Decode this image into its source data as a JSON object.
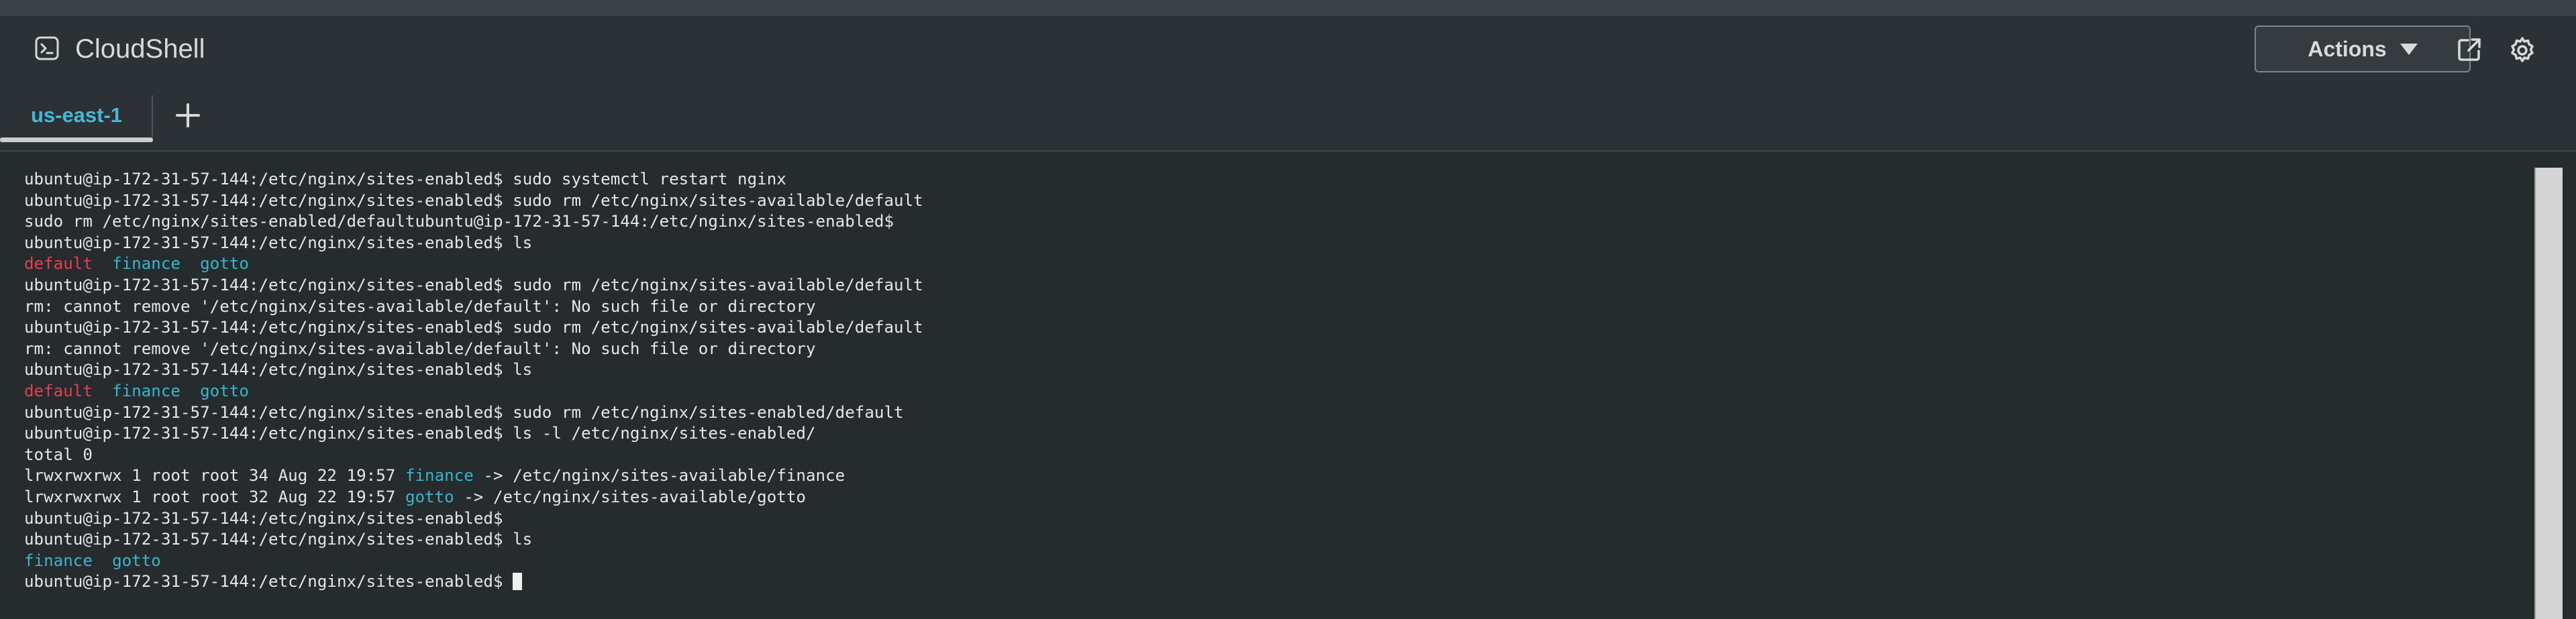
{
  "app": {
    "title": "CloudShell"
  },
  "header": {
    "actions_label": "Actions",
    "icons": [
      "terminal-icon",
      "external-link-icon",
      "gear-icon",
      "caret-down-icon"
    ]
  },
  "tabs": [
    {
      "label": "us-east-1",
      "active": true
    }
  ],
  "add_tab_label": "+",
  "terminal": {
    "lines": [
      [
        {
          "text": "ubuntu@ip-172-31-57-144:/etc/nginx/sites-enabled$ sudo systemctl restart nginx",
          "style": "normal"
        }
      ],
      [
        {
          "text": "ubuntu@ip-172-31-57-144:/etc/nginx/sites-enabled$ sudo rm /etc/nginx/sites-available/default",
          "style": "normal"
        }
      ],
      [
        {
          "text": "sudo rm /etc/nginx/sites-enabled/defaultubuntu@ip-172-31-57-144:/etc/nginx/sites-enabled$",
          "style": "normal"
        }
      ],
      [
        {
          "text": "ubuntu@ip-172-31-57-144:/etc/nginx/sites-enabled$ ls",
          "style": "normal"
        }
      ],
      [
        {
          "text": "default",
          "style": "default"
        },
        {
          "text": "  ",
          "style": "normal"
        },
        {
          "text": "finance",
          "style": "dir"
        },
        {
          "text": "  ",
          "style": "normal"
        },
        {
          "text": "gotto",
          "style": "dir"
        }
      ],
      [
        {
          "text": "ubuntu@ip-172-31-57-144:/etc/nginx/sites-enabled$ sudo rm /etc/nginx/sites-available/default",
          "style": "normal"
        }
      ],
      [
        {
          "text": "rm: cannot remove '/etc/nginx/sites-available/default': No such file or directory",
          "style": "normal"
        }
      ],
      [
        {
          "text": "ubuntu@ip-172-31-57-144:/etc/nginx/sites-enabled$ sudo rm /etc/nginx/sites-available/default",
          "style": "normal"
        }
      ],
      [
        {
          "text": "rm: cannot remove '/etc/nginx/sites-available/default': No such file or directory",
          "style": "normal"
        }
      ],
      [
        {
          "text": "ubuntu@ip-172-31-57-144:/etc/nginx/sites-enabled$ ls",
          "style": "normal"
        }
      ],
      [
        {
          "text": "default",
          "style": "default"
        },
        {
          "text": "  ",
          "style": "normal"
        },
        {
          "text": "finance",
          "style": "dir"
        },
        {
          "text": "  ",
          "style": "normal"
        },
        {
          "text": "gotto",
          "style": "dir"
        }
      ],
      [
        {
          "text": "ubuntu@ip-172-31-57-144:/etc/nginx/sites-enabled$ sudo rm /etc/nginx/sites-enabled/default",
          "style": "normal"
        }
      ],
      [
        {
          "text": "ubuntu@ip-172-31-57-144:/etc/nginx/sites-enabled$ ls -l /etc/nginx/sites-enabled/",
          "style": "normal"
        }
      ],
      [
        {
          "text": "total 0",
          "style": "normal"
        }
      ],
      [
        {
          "text": "lrwxrwxrwx 1 root root 34 Aug 22 19:57 ",
          "style": "normal"
        },
        {
          "text": "finance",
          "style": "dir"
        },
        {
          "text": " -> /etc/nginx/sites-available/finance",
          "style": "normal"
        }
      ],
      [
        {
          "text": "lrwxrwxrwx 1 root root 32 Aug 22 19:57 ",
          "style": "normal"
        },
        {
          "text": "gotto",
          "style": "dir"
        },
        {
          "text": " -> /etc/nginx/sites-available/gotto",
          "style": "normal"
        }
      ],
      [
        {
          "text": "ubuntu@ip-172-31-57-144:/etc/nginx/sites-enabled$",
          "style": "normal"
        }
      ],
      [
        {
          "text": "ubuntu@ip-172-31-57-144:/etc/nginx/sites-enabled$ ls",
          "style": "normal"
        }
      ],
      [
        {
          "text": "finance",
          "style": "dir"
        },
        {
          "text": "  ",
          "style": "normal"
        },
        {
          "text": "gotto",
          "style": "dir"
        }
      ],
      [
        {
          "text": "ubuntu@ip-172-31-57-144:/etc/nginx/sites-enabled$ ",
          "style": "normal"
        },
        {
          "text": "",
          "style": "cursor"
        }
      ]
    ]
  },
  "colors": {
    "accent": "#44b9d6",
    "directory": "#35b6cf",
    "broken_link": "#e2414b",
    "terminal_bg": "#262b2e",
    "header_bg": "#2b3134"
  }
}
